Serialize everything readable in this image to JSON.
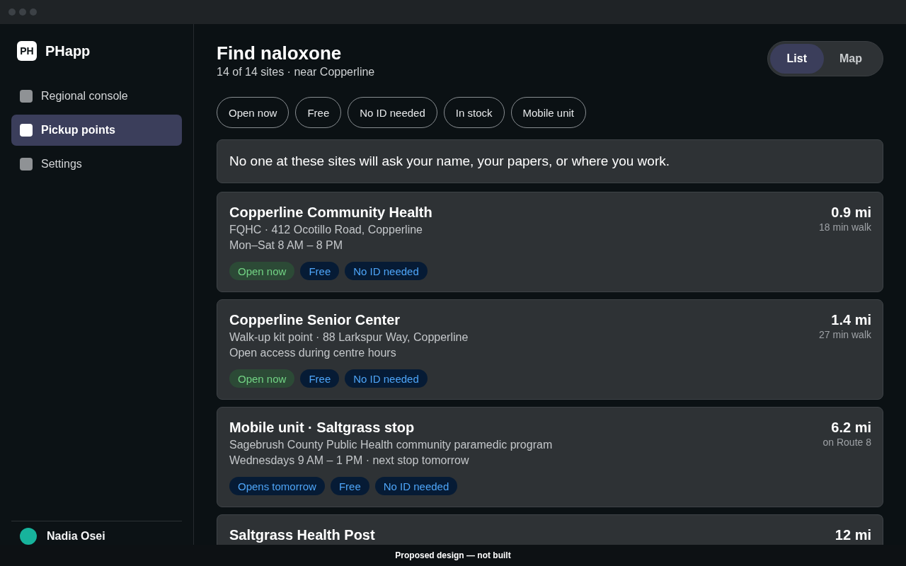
{
  "sidebar": {
    "logo": "PH",
    "app_name": "PHapp",
    "items": [
      {
        "label": "Regional console",
        "selected": false
      },
      {
        "label": "Pickup points",
        "selected": true
      },
      {
        "label": "Settings",
        "selected": false
      }
    ],
    "user": {
      "name": "Nadia Osei"
    }
  },
  "header": {
    "title": "Find naloxone",
    "subtitle": "14 of 14 sites · near Copperline"
  },
  "view_toggle": [
    {
      "label": "List",
      "selected": true
    },
    {
      "label": "Map",
      "selected": false
    }
  ],
  "filters": [
    {
      "label": "Open now",
      "selected": false
    },
    {
      "label": "Free",
      "selected": false
    },
    {
      "label": "No ID needed",
      "selected": false
    },
    {
      "label": "In stock",
      "selected": false
    },
    {
      "label": "Mobile unit",
      "selected": false
    }
  ],
  "notice": "No one at these sites will ask your name, your papers, or where you work.",
  "sites": [
    {
      "name": "Copperline Community Health",
      "details": "FQHC · 412 Ocotillo Road, Copperline",
      "hours": "Mon–Sat 8 AM – 8 PM",
      "distance": "0.9 mi",
      "travel": "18 min walk",
      "tags": [
        {
          "label": "Open now",
          "kind": "success"
        },
        {
          "label": "Free",
          "kind": "info"
        },
        {
          "label": "No ID needed",
          "kind": "info"
        }
      ]
    },
    {
      "name": "Copperline Senior Center",
      "details": "Walk-up kit point · 88 Larkspur Way, Copperline",
      "hours": "Open access during centre hours",
      "distance": "1.4 mi",
      "travel": "27 min walk",
      "tags": [
        {
          "label": "Open now",
          "kind": "success"
        },
        {
          "label": "Free",
          "kind": "info"
        },
        {
          "label": "No ID needed",
          "kind": "info"
        }
      ]
    },
    {
      "name": "Mobile unit · Saltgrass stop",
      "details": "Sagebrush County Public Health community paramedic program",
      "hours": "Wednesdays 9 AM – 1 PM · next stop tomorrow",
      "distance": "6.2 mi",
      "travel": "on Route 8",
      "tags": [
        {
          "label": "Opens tomorrow",
          "kind": "info"
        },
        {
          "label": "Free",
          "kind": "info"
        },
        {
          "label": "No ID needed",
          "kind": "info"
        }
      ]
    },
    {
      "name": "Saltgrass Health Post",
      "distance": "12 mi"
    }
  ],
  "banner": "Proposed design — not built"
}
